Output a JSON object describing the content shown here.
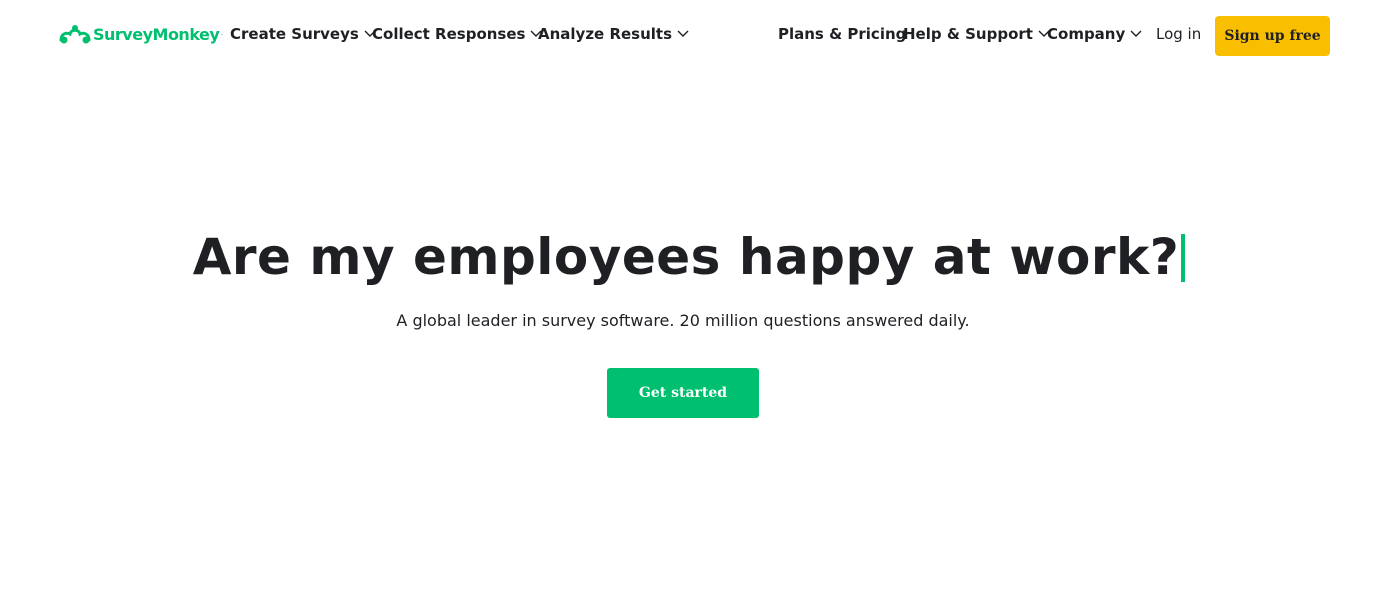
{
  "brand": {
    "name": "SurveyMonkey",
    "mark": "·",
    "color": "#00bf6f",
    "icon": "monkey-logo-icon"
  },
  "nav": {
    "left_items": [
      {
        "label": "Create Surveys",
        "icon": "chevron-down-icon"
      },
      {
        "label": "Collect Responses",
        "icon": "chevron-down-icon"
      },
      {
        "label": "Analyze Results",
        "icon": "chevron-down-icon"
      }
    ],
    "right_items": [
      {
        "label": "Plans & Pricing"
      },
      {
        "label": "Help & Support",
        "icon": "chevron-down-icon"
      },
      {
        "label": "Company",
        "icon": "chevron-down-icon"
      }
    ],
    "login_label": "Log in",
    "signup_label": "Sign up free",
    "signup_color": "#f9be00"
  },
  "hero": {
    "title": "Are my employees happy at work?",
    "subtitle": "A global leader in survey software. 20 million questions answered daily.",
    "cta_label": "Get started",
    "accent": "#00bf6f"
  }
}
